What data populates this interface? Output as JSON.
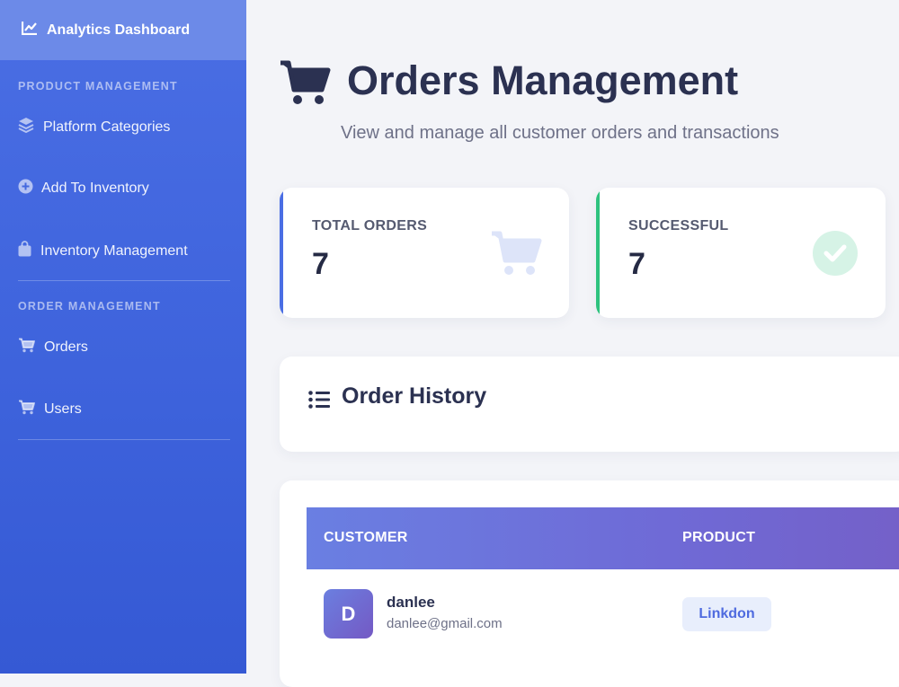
{
  "sidebar": {
    "top_item": {
      "label": "Analytics Dashboard",
      "icon": "chart-line-icon"
    },
    "sections": [
      {
        "title": "PRODUCT MANAGEMENT",
        "items": [
          {
            "label": "Platform Categories",
            "icon": "layers-icon"
          },
          {
            "label": "Add To Inventory",
            "icon": "plus-circle-icon"
          },
          {
            "label": "Inventory Management",
            "icon": "shopping-bag-icon"
          }
        ]
      },
      {
        "title": "ORDER MANAGEMENT",
        "items": [
          {
            "label": "Orders",
            "icon": "cart-icon"
          },
          {
            "label": "Users",
            "icon": "cart-icon"
          }
        ]
      }
    ]
  },
  "header": {
    "title": "Orders Management",
    "subtitle": "View and manage all customer orders and transactions"
  },
  "stats": [
    {
      "label": "TOTAL ORDERS",
      "value": "7",
      "accent": "#4a6ee4",
      "icon": "cart-icon"
    },
    {
      "label": "SUCCESSFUL",
      "value": "7",
      "accent": "#2ec27e",
      "icon": "check-circle-icon"
    }
  ],
  "order_history": {
    "title": "Order History",
    "columns": [
      "CUSTOMER",
      "PRODUCT"
    ],
    "rows": [
      {
        "avatar_letter": "D",
        "name": "danlee",
        "email": "danlee@gmail.com",
        "product": "Linkdon"
      }
    ]
  },
  "colors": {
    "sidebar": "#4a6ee4",
    "title": "#2b3151",
    "accent_blue": "#4a6ee4",
    "accent_green": "#2ec27e"
  }
}
